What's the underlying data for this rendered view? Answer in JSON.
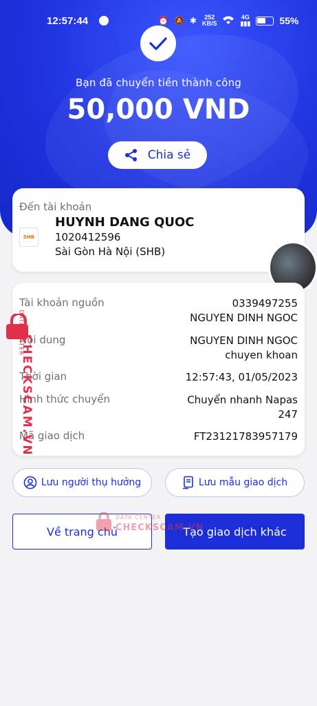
{
  "status_bar": {
    "time": "12:57:44",
    "net_speed_top": "252",
    "net_speed_bottom": "KB/S",
    "net_type": "4G",
    "battery": "55%"
  },
  "hero": {
    "success_message": "Bạn đã chuyển tiền thành công",
    "amount": "50,000 VND",
    "share_label": "Chia sẻ"
  },
  "recipient": {
    "label": "Đến tài khoản",
    "bank_logo_text": "SHB",
    "name": "HUYNH DANG QUOC",
    "account_number": "1020412596",
    "bank_name": "Sài Gòn Hà Nội (SHB)"
  },
  "details": {
    "source_label": "Tài khoản nguồn",
    "source_account": "0339497255",
    "source_name": "NGUYEN DINH NGOC",
    "content_label": "Nội dung",
    "content_line1": "NGUYEN DINH NGOC",
    "content_line2": "chuyen khoan",
    "time_label": "Thời gian",
    "time_value": "12:57:43, 01/05/2023",
    "method_label": "Hình thức chuyển",
    "method_line1": "Chuyển nhanh Napas",
    "method_line2": "247",
    "txn_label": "Mã giao dịch",
    "txn_value": "FT23121783957179"
  },
  "actions": {
    "save_beneficiary": "Lưu người thụ hưởng",
    "save_template": "Lưu mẫu giao dịch",
    "home": "Về trang chủ",
    "new_transaction": "Tạo giao dịch khác"
  },
  "watermark": {
    "side_text": "CHECKSCAM.VN",
    "side_sub": "DATA CENTER",
    "center_top": "DATA CENTER",
    "center_main": "CHECKSCAM.VN"
  },
  "colors": {
    "primary": "#1c2ed8",
    "hero": "#1f33e0",
    "watermark": "#e0314a"
  }
}
